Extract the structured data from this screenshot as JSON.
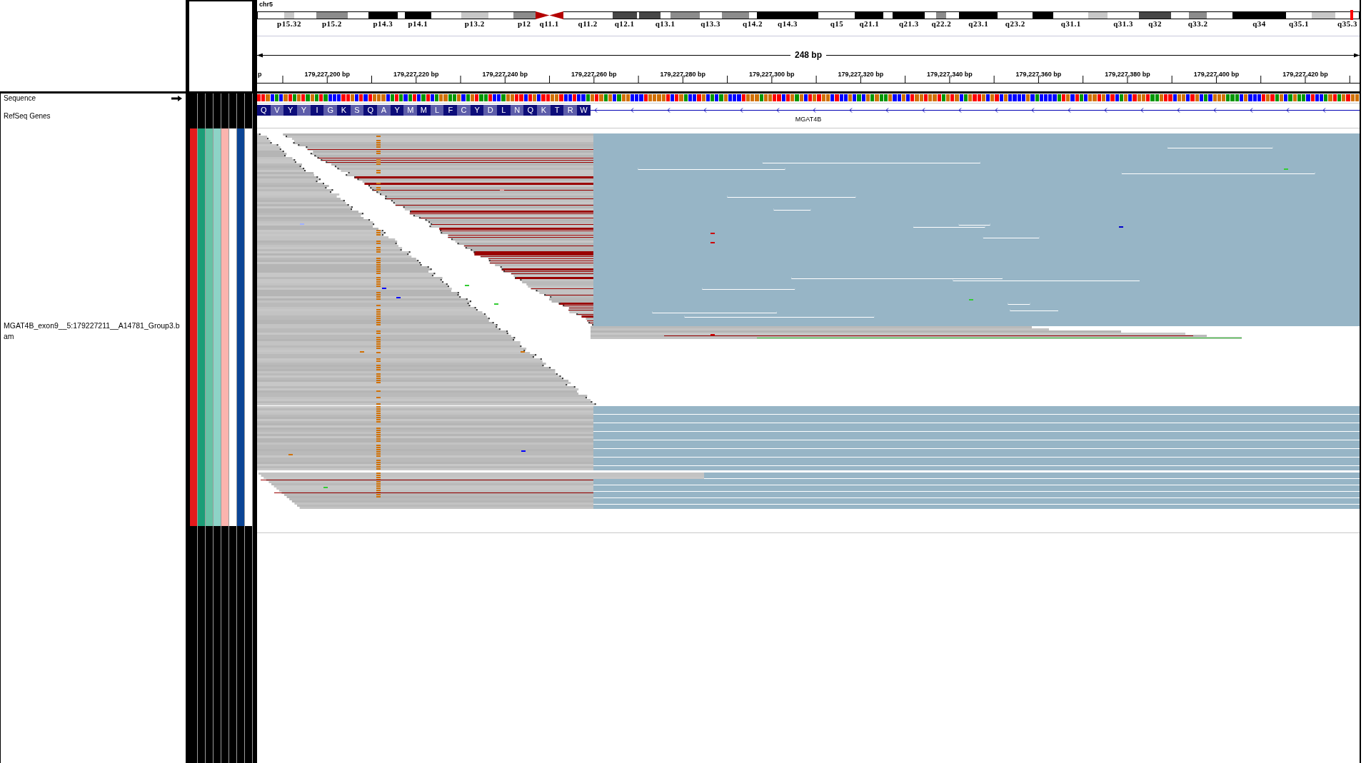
{
  "header": {
    "chromosome": "chr5"
  },
  "ideogram": {
    "bands": [
      {
        "kind": "band",
        "color": "#ffffff"
      },
      {
        "kind": "band",
        "color": "#c8c8c8",
        "label": "p15.32"
      },
      {
        "kind": "band",
        "color": "#ffffff"
      },
      {
        "kind": "band",
        "color": "#8c8c8c",
        "label": "p15.2"
      },
      {
        "kind": "band",
        "color": "#ffffff"
      },
      {
        "kind": "band",
        "color": "#000000",
        "label": "p14.3"
      },
      {
        "kind": "band",
        "color": "#ffffff"
      },
      {
        "kind": "band",
        "color": "#000000",
        "label": "p14.1"
      },
      {
        "kind": "band",
        "color": "#ffffff"
      },
      {
        "kind": "band",
        "color": "#c8c8c8",
        "label": "p13.2"
      },
      {
        "kind": "band",
        "color": "#ffffff"
      },
      {
        "kind": "band",
        "color": "#8c8c8c",
        "label": "p12"
      },
      {
        "kind": "centromere",
        "color": "#b40000",
        "label": "q11.1"
      },
      {
        "kind": "band",
        "color": "#ffffff",
        "label": "q11.2"
      },
      {
        "kind": "band",
        "color": "#464646",
        "label": "q12.1"
      },
      {
        "kind": "band",
        "color": "#ffffff"
      },
      {
        "kind": "band",
        "color": "#464646"
      },
      {
        "kind": "band",
        "color": "#ffffff",
        "label": "q13.1"
      },
      {
        "kind": "band",
        "color": "#8c8c8c"
      },
      {
        "kind": "band",
        "color": "#ffffff",
        "label": "q13.3"
      },
      {
        "kind": "band",
        "color": "#8c8c8c"
      },
      {
        "kind": "band",
        "color": "#ffffff",
        "label": "q14.2"
      },
      {
        "kind": "band",
        "color": "#000000",
        "label": "q14.3"
      },
      {
        "kind": "band",
        "color": "#ffffff",
        "label": "q15"
      },
      {
        "kind": "band",
        "color": "#000000",
        "label": "q21.1"
      },
      {
        "kind": "band",
        "color": "#ffffff"
      },
      {
        "kind": "band",
        "color": "#000000",
        "label": "q21.3"
      },
      {
        "kind": "band",
        "color": "#ffffff"
      },
      {
        "kind": "band",
        "color": "#8c8c8c",
        "label": "q22.2"
      },
      {
        "kind": "band",
        "color": "#ffffff"
      },
      {
        "kind": "band",
        "color": "#000000",
        "label": "q23.1"
      },
      {
        "kind": "band",
        "color": "#ffffff",
        "label": "q23.2"
      },
      {
        "kind": "band",
        "color": "#000000"
      },
      {
        "kind": "band",
        "color": "#ffffff",
        "label": "q31.1"
      },
      {
        "kind": "band",
        "color": "#c8c8c8"
      },
      {
        "kind": "band",
        "color": "#ffffff",
        "label": "q31.3"
      },
      {
        "kind": "band",
        "color": "#464646",
        "label": "q32"
      },
      {
        "kind": "band",
        "color": "#ffffff"
      },
      {
        "kind": "band",
        "color": "#8c8c8c",
        "label": "q33.2"
      },
      {
        "kind": "band",
        "color": "#ffffff"
      },
      {
        "kind": "band",
        "color": "#000000",
        "label": "q34"
      },
      {
        "kind": "band",
        "color": "#ffffff",
        "label": "q35.1"
      },
      {
        "kind": "band",
        "color": "#c8c8c8"
      },
      {
        "kind": "band",
        "color": "#ffffff",
        "label": "q35.3"
      }
    ]
  },
  "ruler": {
    "span": "248 bp",
    "tick_labels": [
      "p",
      "179,227,200 bp",
      "179,227,220 bp",
      "179,227,240 bp",
      "179,227,260 bp",
      "179,227,280 bp",
      "179,227,300 bp",
      "179,227,320 bp",
      "179,227,340 bp",
      "179,227,360 bp",
      "179,227,380 bp",
      "179,227,400 bp",
      "179,227,420 bp"
    ]
  },
  "tracks": [
    {
      "kind": "sequence",
      "name": "Sequence",
      "forward": true,
      "bases": [
        {
          "color": "#ff0000"
        },
        {
          "color": "#ff0000"
        },
        {
          "color": "#d17105"
        },
        {
          "color": "#0000ff"
        },
        {
          "color": "#009600"
        },
        {
          "color": "#0000ff"
        },
        {
          "color": "#d17105"
        },
        {
          "color": "#ff0000"
        },
        {
          "color": "#009600"
        },
        {
          "color": "#d17105"
        },
        {
          "color": "#ff0000"
        },
        {
          "color": "#009600"
        },
        {
          "color": "#d17105"
        },
        {
          "color": "#009600"
        },
        {
          "color": "#ff0000"
        },
        {
          "color": "#009600"
        },
        {
          "color": "#0000ff"
        },
        {
          "color": "#0000ff"
        },
        {
          "color": "#0000ff"
        },
        {
          "color": "#ff0000"
        },
        {
          "color": "#ff0000"
        },
        {
          "color": "#d17105"
        },
        {
          "color": "#0000ff"
        },
        {
          "color": "#ff0000"
        },
        {
          "color": "#0000ff"
        },
        {
          "color": "#ff0000"
        },
        {
          "color": "#d17105"
        },
        {
          "color": "#d17105"
        },
        {
          "color": "#d17105"
        },
        {
          "color": "#0000ff"
        },
        {
          "color": "#009600"
        },
        {
          "color": "#ff0000"
        },
        {
          "color": "#009600"
        },
        {
          "color": "#0000ff"
        },
        {
          "color": "#009600"
        },
        {
          "color": "#ff0000"
        },
        {
          "color": "#0000ff"
        },
        {
          "color": "#009600"
        },
        {
          "color": "#ff0000"
        },
        {
          "color": "#0000ff"
        },
        {
          "color": "#009600"
        },
        {
          "color": "#d17105"
        },
        {
          "color": "#d17105"
        },
        {
          "color": "#009600"
        },
        {
          "color": "#009600"
        },
        {
          "color": "#d17105"
        },
        {
          "color": "#0000ff"
        },
        {
          "color": "#009600"
        },
        {
          "color": "#d17105"
        },
        {
          "color": "#ff0000"
        },
        {
          "color": "#009600"
        },
        {
          "color": "#009600"
        },
        {
          "color": "#ff0000"
        },
        {
          "color": "#0000ff"
        },
        {
          "color": "#0000ff"
        },
        {
          "color": "#009600"
        },
        {
          "color": "#d17105"
        },
        {
          "color": "#d17105"
        },
        {
          "color": "#ff0000"
        },
        {
          "color": "#ff0000"
        },
        {
          "color": "#0000ff"
        },
        {
          "color": "#ff0000"
        },
        {
          "color": "#d17105"
        },
        {
          "color": "#0000ff"
        },
        {
          "color": "#ff0000"
        },
        {
          "color": "#ff0000"
        },
        {
          "color": "#d17105"
        },
        {
          "color": "#d17105"
        },
        {
          "color": "#ff0000"
        },
        {
          "color": "#0000ff"
        },
        {
          "color": "#0000ff"
        },
        {
          "color": "#ff0000"
        },
        {
          "color": "#0000ff"
        },
        {
          "color": "#0000ff"
        },
        {
          "color": "#009600"
        },
        {
          "color": "#d17105"
        },
        {
          "color": "#ff0000"
        },
        {
          "color": "#d17105"
        },
        {
          "color": "#009600"
        },
        {
          "color": "#d17105"
        },
        {
          "color": "#0000ff"
        },
        {
          "color": "#009600"
        },
        {
          "color": "#d17105"
        },
        {
          "color": "#d17105"
        },
        {
          "color": "#0000ff"
        },
        {
          "color": "#0000ff"
        },
        {
          "color": "#0000ff"
        },
        {
          "color": "#ff0000"
        },
        {
          "color": "#d17105"
        },
        {
          "color": "#d17105"
        },
        {
          "color": "#d17105"
        },
        {
          "color": "#d17105"
        },
        {
          "color": "#ff0000"
        },
        {
          "color": "#0000ff"
        },
        {
          "color": "#ff0000"
        },
        {
          "color": "#d17105"
        },
        {
          "color": "#009600"
        },
        {
          "color": "#0000ff"
        },
        {
          "color": "#0000ff"
        },
        {
          "color": "#ff0000"
        },
        {
          "color": "#d17105"
        },
        {
          "color": "#0000ff"
        },
        {
          "color": "#009600"
        },
        {
          "color": "#0000ff"
        },
        {
          "color": "#009600"
        },
        {
          "color": "#d17105"
        },
        {
          "color": "#0000ff"
        },
        {
          "color": "#0000ff"
        },
        {
          "color": "#0000ff"
        },
        {
          "color": "#ff0000"
        },
        {
          "color": "#d17105"
        },
        {
          "color": "#d17105"
        },
        {
          "color": "#d17105"
        },
        {
          "color": "#009600"
        },
        {
          "color": "#d17105"
        },
        {
          "color": "#d17105"
        },
        {
          "color": "#ff0000"
        },
        {
          "color": "#ff0000"
        },
        {
          "color": "#0000ff"
        },
        {
          "color": "#ff0000"
        },
        {
          "color": "#d17105"
        },
        {
          "color": "#009600"
        },
        {
          "color": "#d17105"
        },
        {
          "color": "#0000ff"
        },
        {
          "color": "#ff0000"
        },
        {
          "color": "#d17105"
        },
        {
          "color": "#ff0000"
        },
        {
          "color": "#d17105"
        },
        {
          "color": "#d17105"
        },
        {
          "color": "#0000ff"
        },
        {
          "color": "#ff0000"
        },
        {
          "color": "#0000ff"
        },
        {
          "color": "#0000ff"
        },
        {
          "color": "#d17105"
        },
        {
          "color": "#0000ff"
        },
        {
          "color": "#009600"
        },
        {
          "color": "#0000ff"
        },
        {
          "color": "#d17105"
        },
        {
          "color": "#009600"
        },
        {
          "color": "#d17105"
        },
        {
          "color": "#009600"
        },
        {
          "color": "#009600"
        },
        {
          "color": "#d17105"
        },
        {
          "color": "#0000ff"
        },
        {
          "color": "#0000ff"
        },
        {
          "color": "#d17105"
        },
        {
          "color": "#0000ff"
        },
        {
          "color": "#ff0000"
        },
        {
          "color": "#d17105"
        },
        {
          "color": "#d17105"
        },
        {
          "color": "#ff0000"
        },
        {
          "color": "#d17105"
        },
        {
          "color": "#d17105"
        },
        {
          "color": "#ff0000"
        },
        {
          "color": "#009600"
        },
        {
          "color": "#d17105"
        },
        {
          "color": "#ff0000"
        },
        {
          "color": "#d17105"
        },
        {
          "color": "#0000ff"
        },
        {
          "color": "#009600"
        },
        {
          "color": "#d17105"
        },
        {
          "color": "#ff0000"
        },
        {
          "color": "#ff0000"
        },
        {
          "color": "#d17105"
        },
        {
          "color": "#0000ff"
        },
        {
          "color": "#d17105"
        },
        {
          "color": "#ff0000"
        },
        {
          "color": "#0000ff"
        },
        {
          "color": "#d17105"
        },
        {
          "color": "#0000ff"
        },
        {
          "color": "#0000ff"
        },
        {
          "color": "#0000ff"
        },
        {
          "color": "#0000ff"
        },
        {
          "color": "#d17105"
        },
        {
          "color": "#0000ff"
        },
        {
          "color": "#009600"
        },
        {
          "color": "#0000ff"
        },
        {
          "color": "#0000ff"
        },
        {
          "color": "#0000ff"
        },
        {
          "color": "#0000ff"
        },
        {
          "color": "#009600"
        },
        {
          "color": "#ff0000"
        },
        {
          "color": "#d17105"
        },
        {
          "color": "#0000ff"
        },
        {
          "color": "#ff0000"
        },
        {
          "color": "#009600"
        },
        {
          "color": "#0000ff"
        },
        {
          "color": "#d17105"
        },
        {
          "color": "#d17105"
        },
        {
          "color": "#ff0000"
        },
        {
          "color": "#d17105"
        },
        {
          "color": "#0000ff"
        },
        {
          "color": "#ff0000"
        },
        {
          "color": "#0000ff"
        },
        {
          "color": "#009600"
        },
        {
          "color": "#d17105"
        },
        {
          "color": "#0000ff"
        },
        {
          "color": "#ff0000"
        },
        {
          "color": "#d17105"
        },
        {
          "color": "#d17105"
        },
        {
          "color": "#ff0000"
        },
        {
          "color": "#009600"
        },
        {
          "color": "#009600"
        },
        {
          "color": "#d17105"
        },
        {
          "color": "#ff0000"
        },
        {
          "color": "#ff0000"
        },
        {
          "color": "#0000ff"
        },
        {
          "color": "#d17105"
        },
        {
          "color": "#d17105"
        },
        {
          "color": "#0000ff"
        },
        {
          "color": "#ff0000"
        },
        {
          "color": "#d17105"
        },
        {
          "color": "#0000ff"
        },
        {
          "color": "#009600"
        },
        {
          "color": "#0000ff"
        },
        {
          "color": "#d17105"
        },
        {
          "color": "#d17105"
        },
        {
          "color": "#d17105"
        },
        {
          "color": "#009600"
        },
        {
          "color": "#009600"
        },
        {
          "color": "#009600"
        },
        {
          "color": "#0000ff"
        },
        {
          "color": "#d17105"
        },
        {
          "color": "#0000ff"
        },
        {
          "color": "#0000ff"
        },
        {
          "color": "#0000ff"
        },
        {
          "color": "#ff0000"
        },
        {
          "color": "#d17105"
        },
        {
          "color": "#ff0000"
        },
        {
          "color": "#009600"
        },
        {
          "color": "#d17105"
        },
        {
          "color": "#0000ff"
        },
        {
          "color": "#009600"
        },
        {
          "color": "#d17105"
        },
        {
          "color": "#009600"
        },
        {
          "color": "#009600"
        },
        {
          "color": "#0000ff"
        },
        {
          "color": "#ff0000"
        },
        {
          "color": "#0000ff"
        },
        {
          "color": "#0000ff"
        },
        {
          "color": "#009600"
        },
        {
          "color": "#d17105"
        },
        {
          "color": "#ff0000"
        },
        {
          "color": "#009600"
        },
        {
          "color": "#d17105"
        },
        {
          "color": "#ff0000"
        },
        {
          "color": "#d17105"
        },
        {
          "color": "#d17105"
        }
      ]
    },
    {
      "kind": "gene",
      "name": "RefSeq Genes",
      "amino_acids": [
        "Q",
        "V",
        "Y",
        "Y",
        "I",
        "G",
        "K",
        "S",
        "Q",
        "A",
        "Y",
        "M",
        "M",
        "L",
        "F",
        "C",
        "Y",
        "D",
        "L",
        "N",
        "Q",
        "K",
        "T",
        "R",
        "W"
      ],
      "gene": {
        "name": "MGAT4B",
        "forward": false
      }
    },
    {
      "kind": "alignment",
      "name": "MGAT4B_exon9__5:179227211__A14781_Group3.bam",
      "attributes": [
        {
          "color": "#e41a1c"
        },
        {
          "color": "#1b9e77"
        },
        {
          "color": "#66c2a5"
        },
        {
          "color": "#8dd3c7"
        },
        {
          "color": "#fbb4ae"
        },
        {
          "color": "#ffffff"
        },
        {
          "color": "#0b4596"
        },
        {
          "color": "#ffffff"
        }
      ]
    }
  ]
}
